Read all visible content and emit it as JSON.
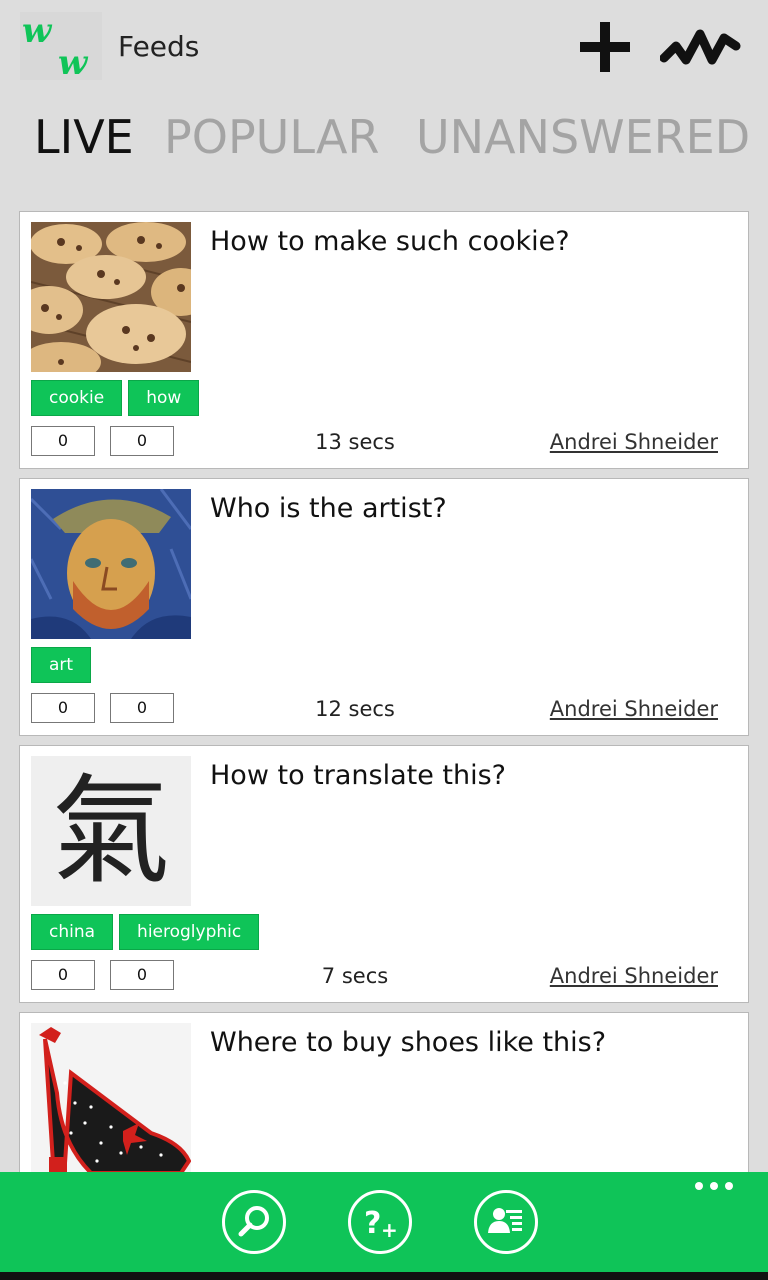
{
  "header": {
    "title": "Feeds",
    "logo_icon": "ww-logo-icon",
    "add_icon": "plus-icon",
    "activity_icon": "pulse-icon"
  },
  "tabs": [
    {
      "label": "LIVE",
      "active": true
    },
    {
      "label": "POPULAR",
      "active": false
    },
    {
      "label": "UNANSWERED",
      "active": false
    }
  ],
  "feed": [
    {
      "title": "How to make such cookie?",
      "image": "cookies-photo",
      "tags": [
        "cookie",
        "how"
      ],
      "up": "0",
      "down": "0",
      "time": "13 secs",
      "author": "Andrei Shneider"
    },
    {
      "title": "Who is the artist?",
      "image": "portrait-painting",
      "tags": [
        "art"
      ],
      "up": "0",
      "down": "0",
      "time": "12 secs",
      "author": "Andrei Shneider"
    },
    {
      "title": "How to translate this?",
      "image": "chinese-character",
      "glyph": "氣",
      "tags": [
        "china",
        "hieroglyphic"
      ],
      "up": "0",
      "down": "0",
      "time": "7 secs",
      "author": "Andrei Shneider"
    },
    {
      "title": "Where to buy shoes like this?",
      "image": "red-polka-dot-shoe"
    }
  ],
  "appbar": {
    "buttons": [
      "search-icon",
      "ask-question-icon",
      "profile-icon"
    ],
    "more": "more-dots-icon"
  },
  "colors": {
    "accent": "#0fc458",
    "background": "#dddddd",
    "tab_inactive": "#a4a4a4"
  }
}
